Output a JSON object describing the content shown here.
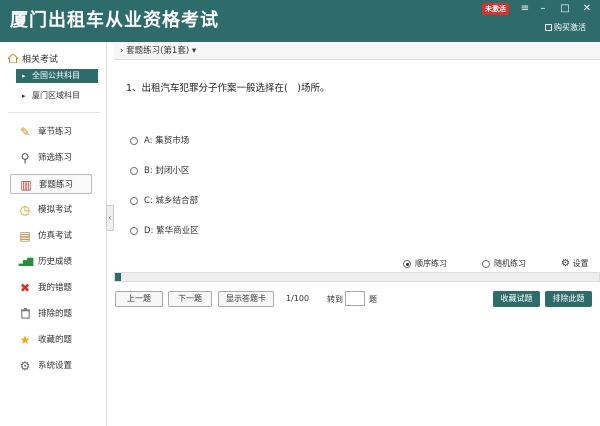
{
  "app": {
    "title": "厦门出租车从业资格考试",
    "badge": "未激活",
    "buy_label": "购买激活",
    "window_controls": [
      "≡",
      "–",
      "□",
      "✕"
    ]
  },
  "sidebar": {
    "header": "相关考试",
    "sub_items": [
      {
        "label": "全国公共科目",
        "active": true
      },
      {
        "label": "厦门区域科目",
        "active": false
      }
    ],
    "nav": [
      {
        "label": "章节练习",
        "icon": "pencil-icon",
        "glyph": "✎",
        "color": "#d08a1a"
      },
      {
        "label": "筛选练习",
        "icon": "search-icon",
        "glyph": "⚲",
        "color": "#555"
      },
      {
        "label": "套题练习",
        "icon": "books-icon",
        "glyph": "▥",
        "color": "#c0392b",
        "active": true
      },
      {
        "label": "模拟考试",
        "icon": "clock-icon",
        "glyph": "◷",
        "color": "#e08a00"
      },
      {
        "label": "仿真考试",
        "icon": "notebook-icon",
        "glyph": "▤",
        "color": "#b07a30"
      },
      {
        "label": "历史成绩",
        "icon": "bar-chart-icon",
        "glyph": "▂▅▇",
        "color": "#2e8b3d"
      },
      {
        "label": "我的错题",
        "icon": "cross-icon",
        "glyph": "✖",
        "color": "#d9302c"
      },
      {
        "label": "排除的题",
        "icon": "trash-icon",
        "glyph": "🗑",
        "color": "#777"
      },
      {
        "label": "收藏的题",
        "icon": "star-icon",
        "glyph": "★",
        "color": "#f0a800"
      },
      {
        "label": "系统设置",
        "icon": "gear-icon",
        "glyph": "⚙",
        "color": "#666"
      }
    ]
  },
  "main": {
    "breadcrumb": "套题练习(第1套)",
    "question": "1、出租汽车犯罪分子作案一般选择在(　)场所。",
    "options": [
      {
        "label": "A: 集贸市场"
      },
      {
        "label": "B: 封闭小区"
      },
      {
        "label": "C: 城乡结合部"
      },
      {
        "label": "D: 繁华商业区"
      }
    ],
    "modes": [
      {
        "label": "顺序练习",
        "selected": true
      },
      {
        "label": "随机练习",
        "selected": false
      }
    ],
    "settings_label": "设置",
    "progress": {
      "current": 1,
      "total": 100
    },
    "buttons": {
      "prev": "上一题",
      "next": "下一题",
      "answer_card": "显示答题卡",
      "favorite": "收藏试题",
      "exclude": "排除此题"
    },
    "pager_text": "1/100",
    "goto_label": "转到",
    "goto_unit": "题"
  }
}
